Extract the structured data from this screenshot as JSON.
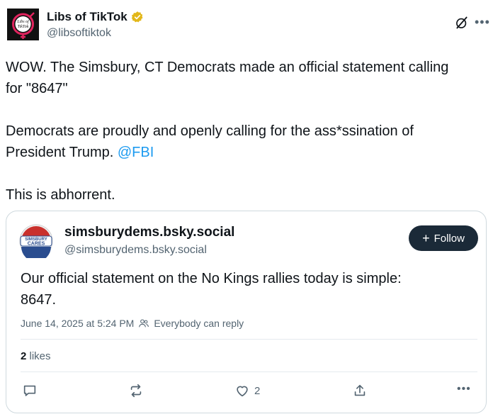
{
  "post": {
    "author_name": "Libs of TikTok",
    "author_handle": "@libsoftiktok",
    "avatar_text_line1": "Libs of",
    "avatar_text_line2": "TikTok",
    "line1": "WOW. The Simsbury, CT Democrats made an official statement calling",
    "line2": "for \"8647\"",
    "line3": "Democrats are proudly and openly calling for the ass*ssination of",
    "line4_text": "President Trump. ",
    "line4_mention": "@FBI",
    "line5": "This is abhorrent."
  },
  "quote": {
    "avatar_text_line1": "SIMSBURY",
    "avatar_text_line2": "CARES",
    "display_name": "simsburydems.bsky.social",
    "handle": "@simsburydems.bsky.social",
    "follow_label": "Follow",
    "text_line1": "Our official statement on the No Kings rallies today is simple:",
    "text_line2": "8647.",
    "timestamp": "June 14, 2025 at 5:24 PM",
    "reply_setting": "Everybody can reply",
    "likes_count": "2",
    "likes_label": " likes",
    "like_action_count": "2"
  },
  "colors": {
    "link": "#1d9bf0",
    "follow_button": "#1b2a38",
    "verified_badge": "#e2b719"
  },
  "icons": [
    "grok-icon",
    "more-icon",
    "verified-badge-icon",
    "people-icon",
    "reply-icon",
    "repost-icon",
    "like-icon",
    "share-icon",
    "more-actions-icon"
  ]
}
